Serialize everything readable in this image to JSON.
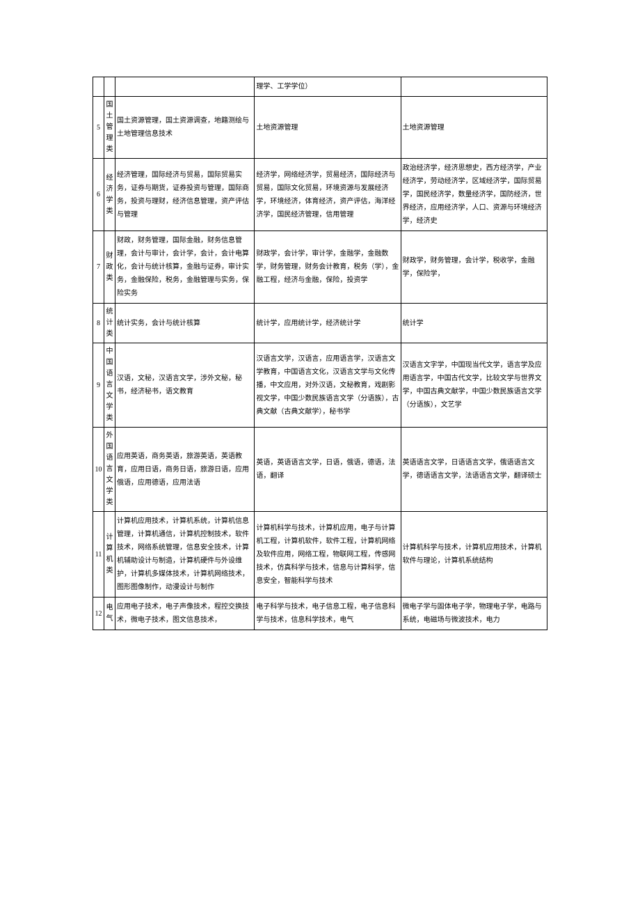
{
  "rows": [
    {
      "idx": "",
      "cat": "",
      "col2": "",
      "col3": "理学、工学学位）",
      "col4": ""
    },
    {
      "idx": "5",
      "cat": "国土管理类",
      "col2": "国土资源管理，国土资源调查，地籍测绘与土地管理信息技术",
      "col3": "土地资源管理",
      "col4": "土地资源管理"
    },
    {
      "idx": "6",
      "cat": "经济学类",
      "col2": "经济管理，国际经济与贸易，国际贸易实务，证券与期货，证券投资与管理，国际商务，投资与理财，经济信息管理，资产评估与管理",
      "col3": "经济学，网络经济学，贸易经济，国际经济与贸易，国际文化贸易，环境资源与发展经济学，环境经济，体育经济，资产评估，海洋经济学，国民经济管理，信用管理",
      "col4": "政治经济学，经济思想史，西方经济学，产业经济学，劳动经济学，区域经济学，国际贸易学，国民经济学，数量经济学，国防经济，世界经济，应用经济学，人口、资源与环境经济学，经济史"
    },
    {
      "idx": "7",
      "cat": "财政类",
      "col2": "财政，财务管理，国际金融，财务信息管理，会计与审计，会计学，会计，会计电算化，会计与统计核算，金融与证券，审计实务，金融保险，税务，金融管理与实务，保险实务",
      "col3": "财政学，会计学，审计学，金融学，金融数学，财务管理，财务会计教育，税务（学），金融工程，经济与金融，保险，投资学",
      "col4": "财政学，财务管理，会计学，税收学，金融学，保险学，"
    },
    {
      "idx": "8",
      "cat": "统计类",
      "col2": "统计实务，会计与统计核算",
      "col3": "统计学，应用统计学，经济统计学",
      "col4": "统计学"
    },
    {
      "idx": "9",
      "cat": "中国语言文学类",
      "col2": "汉语，文秘，汉语言文学，涉外文秘，秘书，经济秘书，语文教育",
      "col3": "汉语言文学，汉语言，应用语言学，汉语言文学教育，中国语言文化，汉语言文学与文化传播，中文应用，对外汉语，文秘教育，戏剧影视文学，中国少数民族语言文学（分语族），古典文献（古典文献学），秘书学",
      "col4": "汉语言文字学，中国现当代文学，语言学及应用语言学，中国古代文学，比较文学与世界文学，中国古典文献学，中国少数民族语言文学（分语族），文艺学"
    },
    {
      "idx": "10",
      "cat": "外国语言文学类",
      "col2": "应用英语，商务英语，旅游英语，英语教育，应用日语，商务日语，旅游日语，应用俄语，应用德语，应用法语",
      "col3": "英语，英语语言文学，日语，俄语，德语，法语，翻译",
      "col4": "英语语言文学，日语语言文学，俄语语言文学，德语语言文学，法语语言文学，翻译硕士"
    },
    {
      "idx": "11",
      "cat": "计算机类",
      "col2": "计算机应用技术，计算机系统，计算机信息管理，计算机通信，计算机控制技术，软件技术，网络系统管理，信息安全技术，计算机辅助设计与制造，计算机硬件与外设维护，计算机多媒体技术，计算机网络技术，图形图像制作，动漫设计与制作",
      "col3": "计算机科学与技术，计算机应用，电子与计算机工程，计算机软件，软件工程，计算机网络及软件应用，网络工程，物联网工程，传感网技术，仿真科学与技术，信息与计算科学，信息安全，智能科学与技术",
      "col4": "计算机科学与技术，计算机应用技术，计算机软件与理论，计算机系统结构"
    },
    {
      "idx": "12",
      "cat": "电气",
      "col2": "应用电子技术，电子声像技术，程控交换技术，微电子技术，图文信息技术，",
      "col3": "电子科学与技术，电子信息工程，电子信息科学与技术，信息科学技术，电气",
      "col4": "微电子学与固体电子学，物理电子学，电路与系统，电磁场与微波技术，电力"
    }
  ]
}
